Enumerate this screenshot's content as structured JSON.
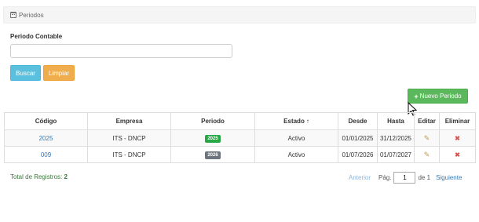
{
  "panel": {
    "title": "Periodos",
    "icon": "calendar-icon"
  },
  "filter": {
    "label": "Periodo Contable",
    "value": "",
    "placeholder": ""
  },
  "buttons": {
    "search": "Buscar",
    "clear": "Limpiar",
    "new_plus": "+",
    "new": "Nuevo Periodo"
  },
  "table": {
    "headers": {
      "code": "Código",
      "company": "Empresa",
      "period": "Periodo",
      "state": "Estado",
      "from": "Desde",
      "to": "Hasta",
      "edit": "Editar",
      "delete": "Eliminar"
    },
    "sort_icon": "↑",
    "rows": [
      {
        "code": "2025",
        "company": "ITS - DNCP",
        "period": "2025",
        "period_color": "#28a745",
        "state": "Activo",
        "from": "01/01/2025",
        "to": "31/12/2025"
      },
      {
        "code": "009",
        "company": "ITS - DNCP",
        "period": "2026",
        "period_color": "#6c757d",
        "state": "Activo",
        "from": "01/07/2026",
        "to": "01/07/2027"
      }
    ]
  },
  "footer": {
    "total_label": "Total de Registros:",
    "total_value": "2",
    "prev": "Anterior",
    "page_label": "Pág.",
    "page_value": "1",
    "of_label": "de 1",
    "next": "Siguiente"
  },
  "colors": {
    "info": "#5bc0de",
    "warning": "#f0ad4e",
    "success": "#5cb85c",
    "link": "#337ab7"
  }
}
